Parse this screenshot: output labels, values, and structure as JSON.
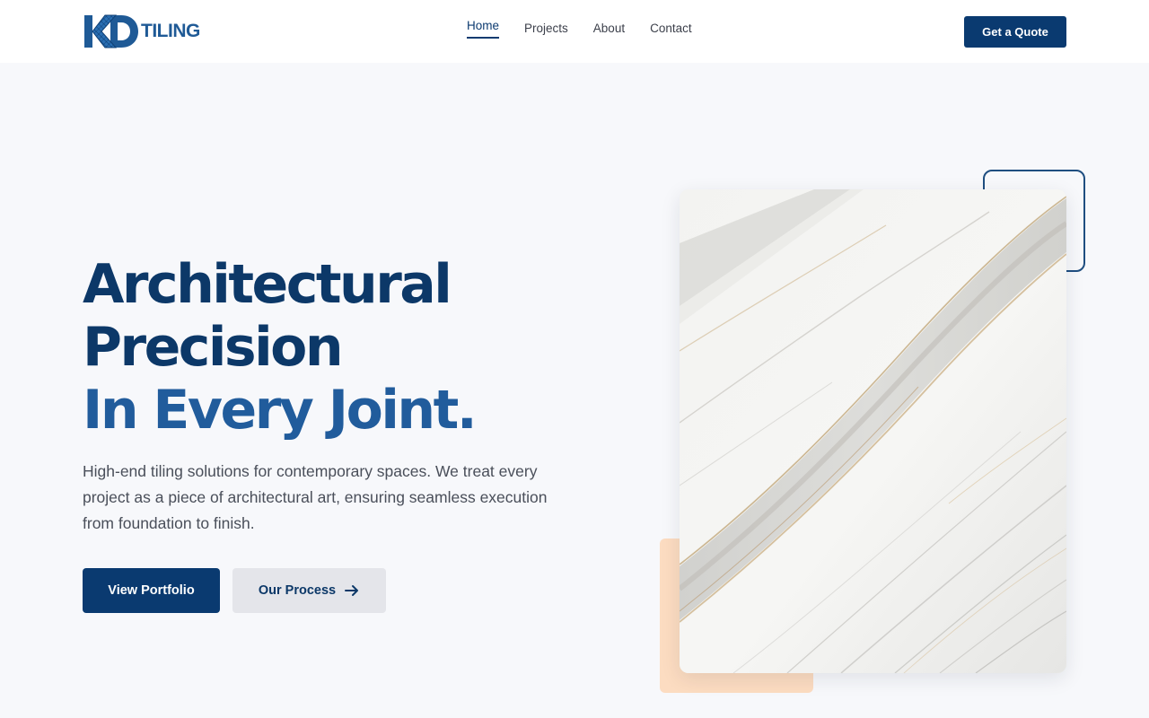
{
  "brand": {
    "logo_letters": "KD",
    "name": "TILING",
    "primary_color": "#0a3a70",
    "accent_color": "#215c9c"
  },
  "nav": {
    "items": [
      {
        "label": "Home",
        "active": true
      },
      {
        "label": "Projects",
        "active": false
      },
      {
        "label": "About",
        "active": false
      },
      {
        "label": "Contact",
        "active": false
      }
    ]
  },
  "header": {
    "cta_label": "Get a Quote"
  },
  "hero": {
    "headline_line1": "Architectural",
    "headline_line2": "Precision",
    "headline_line3": "In Every Joint.",
    "lead": "High-end tiling solutions for contemporary spaces. We treat every project as a piece of architectural art, ensuring seamless execution from foundation to finish.",
    "primary_button": "View Portfolio",
    "secondary_button": "Our Process",
    "secondary_button_icon": "arrow-right-icon",
    "image_subject": "white-marble-tile",
    "decor_accent_color": "#fcdcc1"
  }
}
